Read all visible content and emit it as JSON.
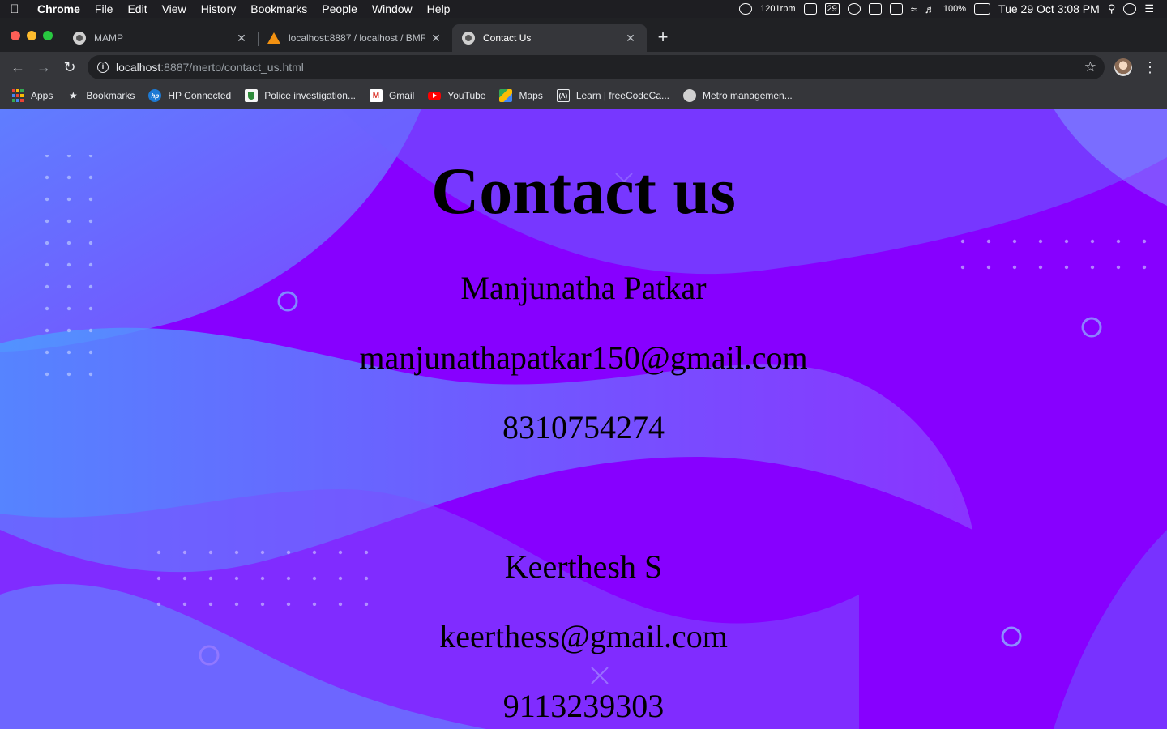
{
  "menubar": {
    "app_name": "Chrome",
    "menus": [
      "File",
      "Edit",
      "View",
      "History",
      "Bookmarks",
      "People",
      "Window",
      "Help"
    ],
    "fan_speed": "1201rpm",
    "calendar_day": "29",
    "battery": "100%",
    "clock": "Tue 29 Oct  3:08 PM"
  },
  "tabs": [
    {
      "title": "MAMP"
    },
    {
      "title": "localhost:8887 / localhost / BMR"
    },
    {
      "title": "Contact Us"
    }
  ],
  "omnibox": {
    "host": "localhost",
    "path": ":8887/merto/contact_us.html"
  },
  "bookmarks": [
    {
      "label": "Apps",
      "icon": "apps-grid-icon"
    },
    {
      "label": "Bookmarks",
      "icon": "star-icon"
    },
    {
      "label": "HP Connected",
      "icon": "hp-icon"
    },
    {
      "label": "Police investigation...",
      "icon": "police-icon"
    },
    {
      "label": "Gmail",
      "icon": "gmail-icon"
    },
    {
      "label": "YouTube",
      "icon": "youtube-icon"
    },
    {
      "label": "Maps",
      "icon": "maps-icon"
    },
    {
      "label": "Learn | freeCodeCa...",
      "icon": "freecodecamp-icon"
    },
    {
      "label": "Metro managemen...",
      "icon": "metro-icon"
    }
  ],
  "page": {
    "heading": "Contact us",
    "contacts": [
      {
        "name": "Manjunatha Patkar",
        "email": "manjunathapatkar150@gmail.com",
        "phone": "8310754274"
      },
      {
        "name": "Keerthesh S",
        "email": "keerthess@gmail.com",
        "phone": "9113239303"
      }
    ]
  },
  "colors": {
    "page_background": "#8700ff",
    "wave_blue": "#4c8dff",
    "chrome_frame": "#202124",
    "chrome_toolbar": "#35363a"
  }
}
